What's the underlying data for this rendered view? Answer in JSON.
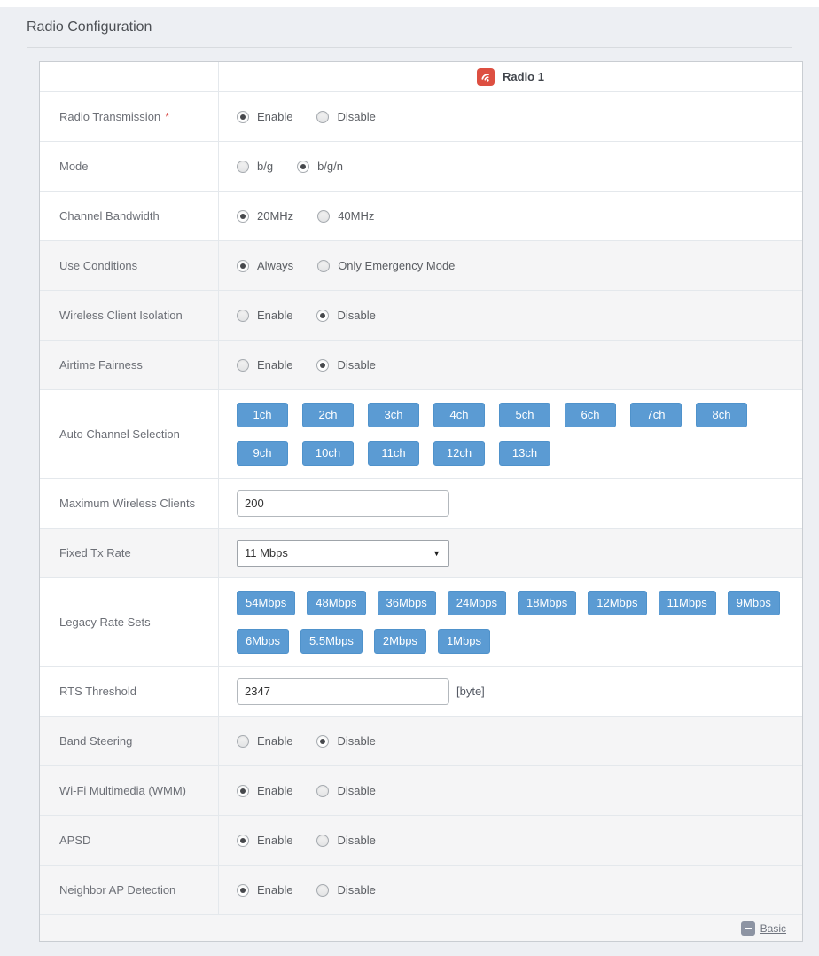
{
  "page": {
    "title": "Radio Configuration"
  },
  "colors": {
    "accent_blue": "#5b9bd3",
    "brand_red": "#dd4f41",
    "shaded_row": "#f5f5f6",
    "required_red": "#d9534f",
    "footer_icon_gray": "#8d94a3"
  },
  "table": {
    "header": {
      "icon": "wifi-icon",
      "radio_title": "Radio 1"
    },
    "rows": [
      {
        "label": "Radio Transmission",
        "required": "*",
        "options": [
          {
            "label": "Enable",
            "selected": true
          },
          {
            "label": "Disable",
            "selected": false
          }
        ]
      },
      {
        "label": "Mode",
        "options": [
          {
            "label": "b/g",
            "selected": false
          },
          {
            "label": "b/g/n",
            "selected": true
          }
        ]
      },
      {
        "label": "Channel Bandwidth",
        "options": [
          {
            "label": "20MHz",
            "selected": true
          },
          {
            "label": "40MHz",
            "selected": false
          }
        ]
      },
      {
        "label": "Use Conditions",
        "options": [
          {
            "label": "Always",
            "selected": true
          },
          {
            "label": "Only Emergency Mode",
            "selected": false
          }
        ]
      },
      {
        "label": "Wireless Client Isolation",
        "options": [
          {
            "label": "Enable",
            "selected": false
          },
          {
            "label": "Disable",
            "selected": true
          }
        ]
      },
      {
        "label": "Airtime Fairness",
        "options": [
          {
            "label": "Enable",
            "selected": false
          },
          {
            "label": "Disable",
            "selected": true
          }
        ]
      },
      {
        "label": "Auto Channel Selection",
        "buttons": [
          "1ch",
          "2ch",
          "3ch",
          "4ch",
          "5ch",
          "6ch",
          "7ch",
          "8ch",
          "9ch",
          "10ch",
          "11ch",
          "12ch",
          "13ch"
        ]
      },
      {
        "label": "Maximum Wireless Clients",
        "input": {
          "value": "200"
        }
      },
      {
        "label": "Fixed Tx Rate",
        "select": {
          "value": "11 Mbps"
        }
      },
      {
        "label": "Legacy Rate Sets",
        "buttons": [
          "54Mbps",
          "48Mbps",
          "36Mbps",
          "24Mbps",
          "18Mbps",
          "12Mbps",
          "11Mbps",
          "9Mbps",
          "6Mbps",
          "5.5Mbps",
          "2Mbps",
          "1Mbps"
        ]
      },
      {
        "label": "RTS Threshold",
        "input": {
          "value": "2347"
        },
        "suffix": "[byte]"
      },
      {
        "label": "Band Steering",
        "options": [
          {
            "label": "Enable",
            "selected": false
          },
          {
            "label": "Disable",
            "selected": true
          }
        ]
      },
      {
        "label": "Wi-Fi Multimedia (WMM)",
        "options": [
          {
            "label": "Enable",
            "selected": true
          },
          {
            "label": "Disable",
            "selected": false
          }
        ]
      },
      {
        "label": "APSD",
        "options": [
          {
            "label": "Enable",
            "selected": true
          },
          {
            "label": "Disable",
            "selected": false
          }
        ]
      },
      {
        "label": "Neighbor AP Detection",
        "options": [
          {
            "label": "Enable",
            "selected": true
          },
          {
            "label": "Disable",
            "selected": false
          }
        ]
      }
    ],
    "footer": {
      "icon": "minus-icon",
      "link_label": "Basic"
    }
  }
}
